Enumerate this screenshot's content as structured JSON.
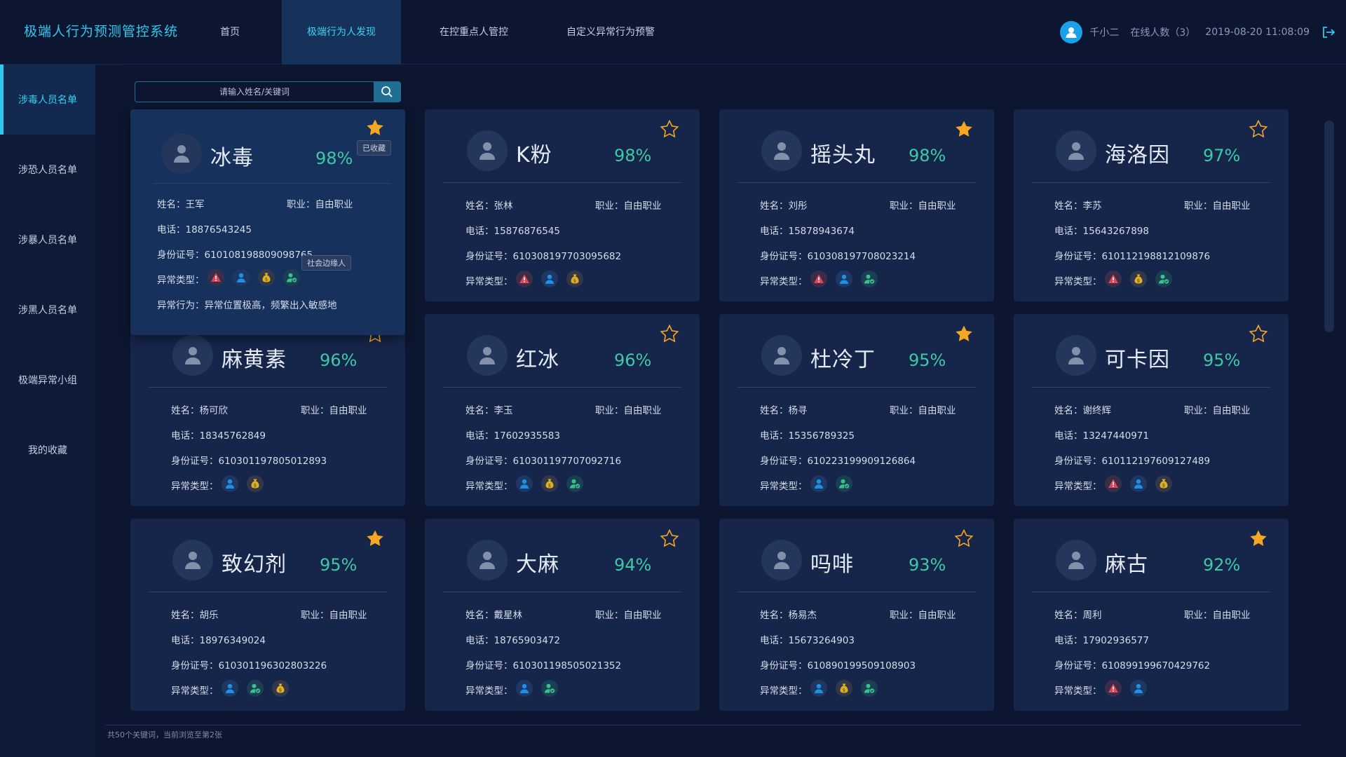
{
  "app": {
    "title": "极端人行为预测管控系统"
  },
  "nav": [
    {
      "label": "首页",
      "active": false
    },
    {
      "label": "极端行为人发现",
      "active": true
    },
    {
      "label": "在控重点人管控",
      "active": false
    },
    {
      "label": "自定义异常行为预警",
      "active": false
    }
  ],
  "user": {
    "name": "千小二",
    "online": "在线人数（3）",
    "datetime": "2019-08-20 11:08:09"
  },
  "sidebar": [
    {
      "label": "涉毒人员名单",
      "active": true
    },
    {
      "label": "涉恐人员名单",
      "active": false
    },
    {
      "label": "涉暴人员名单",
      "active": false
    },
    {
      "label": "涉黑人员名单",
      "active": false
    },
    {
      "label": "极端异常小组",
      "active": false
    },
    {
      "label": "我的收藏",
      "active": false
    }
  ],
  "search": {
    "placeholder": "请输入姓名/关键词"
  },
  "labels": {
    "name": "姓名：",
    "job": "职业：",
    "phone": "电话：",
    "id": "身份证号：",
    "type": "异常类型：",
    "behavior": "异常行为："
  },
  "tooltips": {
    "favorited": "已收藏",
    "social": "社会边缘人"
  },
  "colors": {
    "accent": "#2ec8f0",
    "percent": "#3ec9a6",
    "star": "#f5a623",
    "danger": "#e0455a",
    "user": "#1c8fe8",
    "money": "#e0b020",
    "social": "#39c28e"
  },
  "cards": [
    {
      "title": "冰毒",
      "percent": "98%",
      "starred": true,
      "name": "王军",
      "job": "自由职业",
      "phone": "18876543245",
      "id": "610108198809098765",
      "types": [
        "danger",
        "user",
        "money",
        "social"
      ],
      "behavior": "异常位置极高，频繁出入敏感地"
    },
    {
      "title": "K粉",
      "percent": "98%",
      "starred": false,
      "name": "张林",
      "job": "自由职业",
      "phone": "15876876545",
      "id": "610308197703095682",
      "types": [
        "danger",
        "user",
        "money"
      ]
    },
    {
      "title": "摇头丸",
      "percent": "98%",
      "starred": true,
      "name": "刘彤",
      "job": "自由职业",
      "phone": "15878943674",
      "id": "610308197708023214",
      "types": [
        "danger",
        "user",
        "social"
      ]
    },
    {
      "title": "海洛因",
      "percent": "97%",
      "starred": false,
      "name": "李苏",
      "job": "自由职业",
      "phone": "15643267898",
      "id": "610112198812109876",
      "types": [
        "danger",
        "money",
        "social"
      ]
    },
    {
      "title": "麻黄素",
      "percent": "96%",
      "starred": false,
      "name": "杨可欣",
      "job": "自由职业",
      "phone": "18345762849",
      "id": "610301197805012893",
      "types": [
        "user",
        "money"
      ]
    },
    {
      "title": "红冰",
      "percent": "96%",
      "starred": false,
      "name": "李玉",
      "job": "自由职业",
      "phone": "17602935583",
      "id": "610301197707092716",
      "types": [
        "user",
        "money",
        "social"
      ]
    },
    {
      "title": "杜冷丁",
      "percent": "95%",
      "starred": true,
      "name": "杨寻",
      "job": "自由职业",
      "phone": "15356789325",
      "id": "610223199909126864",
      "types": [
        "user",
        "social"
      ]
    },
    {
      "title": "可卡因",
      "percent": "95%",
      "starred": false,
      "name": "谢终辉",
      "job": "自由职业",
      "phone": "13247440971",
      "id": "610112197609127489",
      "types": [
        "danger",
        "user",
        "money"
      ]
    },
    {
      "title": "致幻剂",
      "percent": "95%",
      "starred": true,
      "name": "胡乐",
      "job": "自由职业",
      "phone": "18976349024",
      "id": "610301196302803226",
      "types": [
        "user",
        "social",
        "money"
      ]
    },
    {
      "title": "大麻",
      "percent": "94%",
      "starred": false,
      "name": "戴星林",
      "job": "自由职业",
      "phone": "18765903472",
      "id": "610301198505021352",
      "types": [
        "user",
        "social"
      ]
    },
    {
      "title": "吗啡",
      "percent": "93%",
      "starred": false,
      "name": "杨易杰",
      "job": "自由职业",
      "phone": "15673264903",
      "id": "610890199509108903",
      "types": [
        "user",
        "money",
        "social"
      ]
    },
    {
      "title": "麻古",
      "percent": "92%",
      "starred": true,
      "name": "周利",
      "job": "自由职业",
      "phone": "17902936577",
      "id": "610899199670429762",
      "types": [
        "danger",
        "user"
      ]
    }
  ],
  "footer": {
    "text": "共50个关键词，当前浏览至第2张"
  }
}
